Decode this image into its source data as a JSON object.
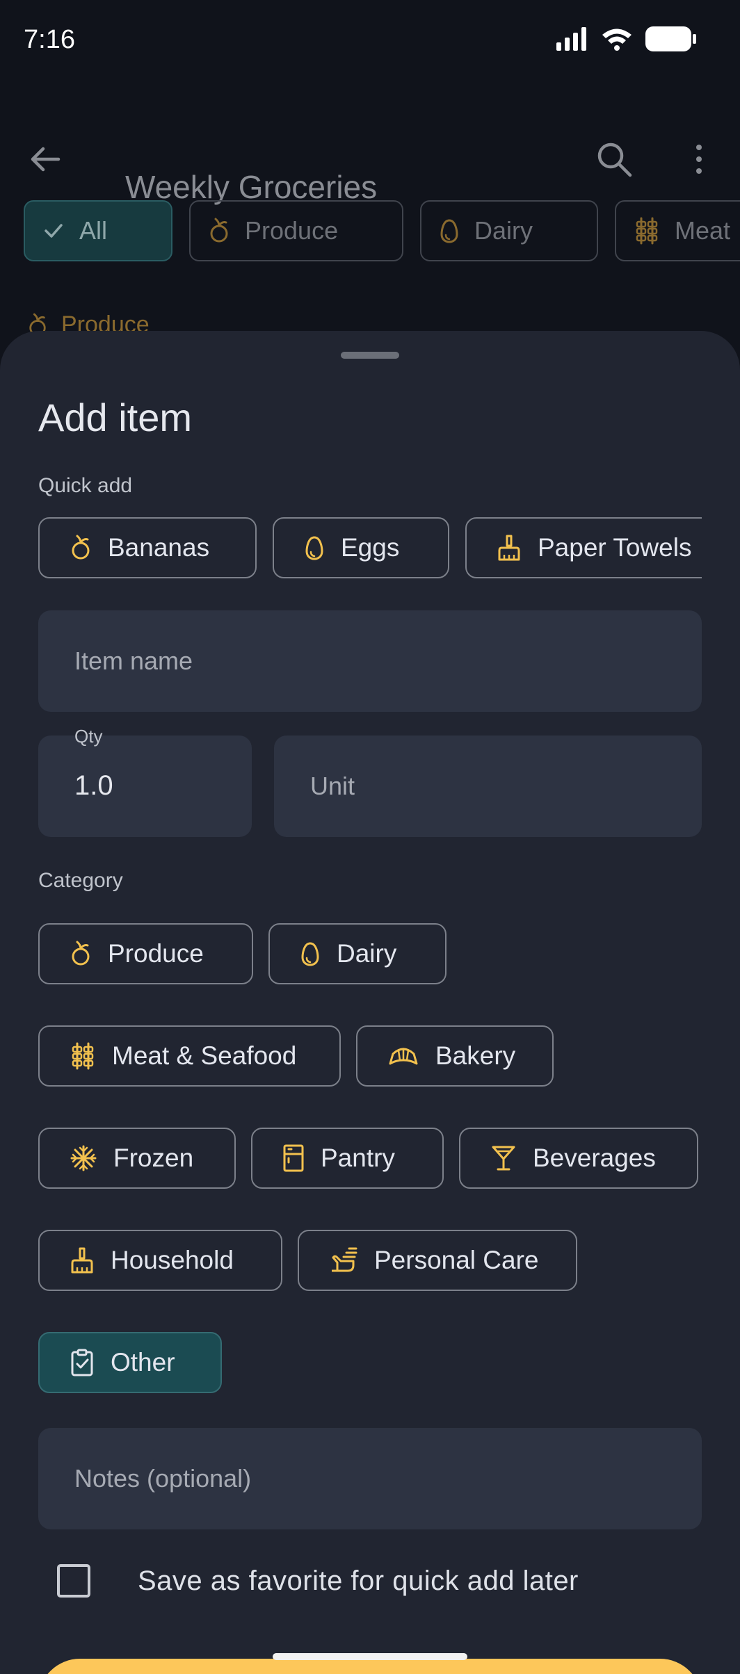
{
  "status": {
    "time": "7:16"
  },
  "app": {
    "title": "Weekly Groceries",
    "filters": [
      {
        "label": "All",
        "icon": "check-icon",
        "selected": true
      },
      {
        "label": "Produce",
        "icon": "fruit-icon"
      },
      {
        "label": "Dairy",
        "icon": "egg-icon"
      },
      {
        "label": "Meat",
        "icon": "skewer-icon"
      }
    ],
    "section_peek": "Produce"
  },
  "sheet": {
    "title": "Add item",
    "quick_add_label": "Quick add",
    "quick_add": [
      {
        "label": "Bananas",
        "icon": "fruit-icon"
      },
      {
        "label": "Eggs",
        "icon": "egg-icon"
      },
      {
        "label": "Paper Towels",
        "icon": "broom-icon"
      }
    ],
    "item_name_placeholder": "Item name",
    "qty_label": "Qty",
    "qty_value": "1.0",
    "unit_placeholder": "Unit",
    "category_label": "Category",
    "categories": [
      {
        "label": "Produce",
        "icon": "fruit-icon"
      },
      {
        "label": "Dairy",
        "icon": "egg-icon"
      },
      {
        "label": "Meat & Seafood",
        "icon": "skewer-icon"
      },
      {
        "label": "Bakery",
        "icon": "croissant-icon"
      },
      {
        "label": "Frozen",
        "icon": "snowflake-icon"
      },
      {
        "label": "Pantry",
        "icon": "cabinet-icon"
      },
      {
        "label": "Beverages",
        "icon": "cocktail-icon"
      },
      {
        "label": "Household",
        "icon": "broom-icon"
      },
      {
        "label": "Personal Care",
        "icon": "hand-wash-icon"
      },
      {
        "label": "Other",
        "icon": "clipboard-check-icon",
        "selected": true
      }
    ],
    "notes_placeholder": "Notes (optional)",
    "favorite_label": "Save as favorite for quick add later",
    "favorite_checked": false
  },
  "colors": {
    "accent": "#fdc75a",
    "icon": "#f2c14e",
    "selected_chip": "#1b4b52",
    "sheet": "#212531"
  }
}
